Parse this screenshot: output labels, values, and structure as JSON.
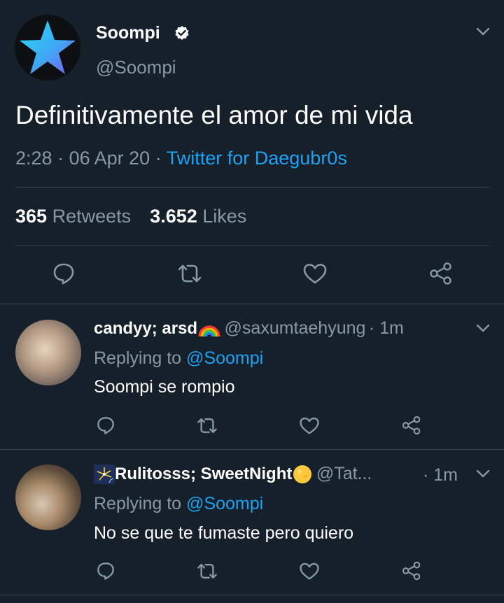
{
  "main_tweet": {
    "display_name": "Soompi",
    "handle": "@Soompi",
    "text": "Definitivamente el amor de mi vida",
    "time": "2:28",
    "date": "06 Apr 20",
    "source": "Twitter for Daegubr0s",
    "sep": "·",
    "retweets_count": "365",
    "retweets_label": "Retweets",
    "likes_count": "3.652",
    "likes_label": "Likes"
  },
  "replies": [
    {
      "display_name": "candyy; arsd",
      "handle": "@saxumtaehyung",
      "time": "· 1m",
      "replying_prefix": "Replying to",
      "replying_to": "@Soompi",
      "text": "Soompi se rompio",
      "name_emoji": "rainbow-emoji"
    },
    {
      "display_name": "Rulitosss; SweetNight",
      "handle": "@Tat...",
      "time": "· 1m",
      "replying_prefix": "Replying to",
      "replying_to": "@Soompi",
      "text": "No se que te fumaste pero quiero",
      "name_emoji": "fireworks-emoji"
    }
  ],
  "colors": {
    "background": "#15202b",
    "text": "#ffffff",
    "muted": "#8899a6",
    "accent": "#1da1f2",
    "divider": "#38444d"
  },
  "icons": [
    "chevron-down-icon",
    "verified-icon",
    "reply-icon",
    "retweet-icon",
    "like-icon",
    "share-icon"
  ]
}
